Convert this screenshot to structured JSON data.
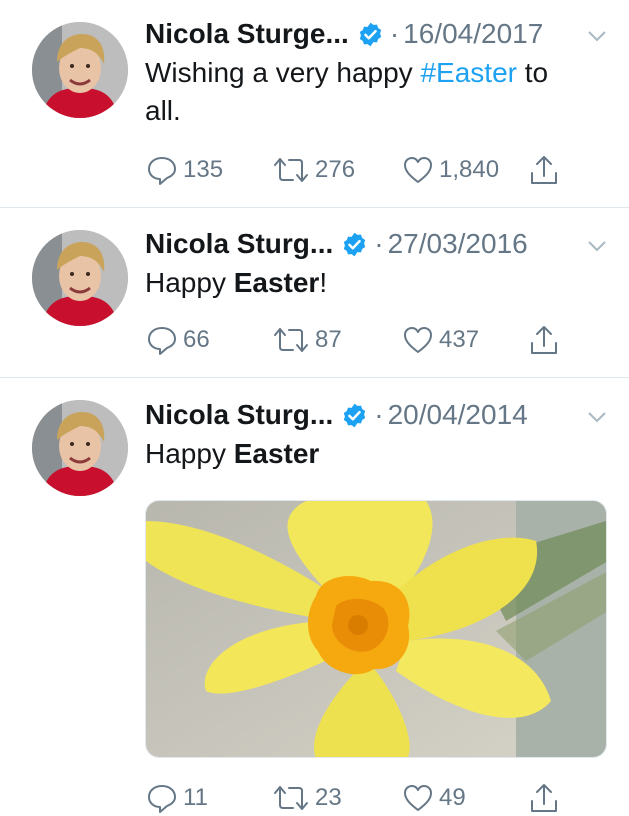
{
  "tweets": [
    {
      "author": "Nicola Sturge...",
      "date": "16/04/2017",
      "text_line1_before": "Wishing a very happy ",
      "hashtag": "#Easter",
      "text_line1_after": " to",
      "text_line2": "all.",
      "replies": "135",
      "retweets": "276",
      "likes": "1,840"
    },
    {
      "author": "Nicola Sturg...",
      "date": "27/03/2016",
      "text_before": "Happy ",
      "text_bold": "Easter",
      "text_after": "!",
      "replies": "66",
      "retweets": "87",
      "likes": "437"
    },
    {
      "author": "Nicola Sturg...",
      "date": "20/04/2014",
      "text_before": "Happy ",
      "text_bold": "Easter",
      "replies": "11",
      "retweets": "23",
      "likes": "49"
    }
  ],
  "separator": "·",
  "icons": [
    "verified-badge-icon",
    "chevron-down-icon",
    "reply-icon",
    "retweet-icon",
    "like-icon",
    "share-icon"
  ],
  "colors": {
    "link": "#1da1f2",
    "muted": "#657786",
    "text": "#14171a",
    "divider": "#e1e8ed"
  }
}
